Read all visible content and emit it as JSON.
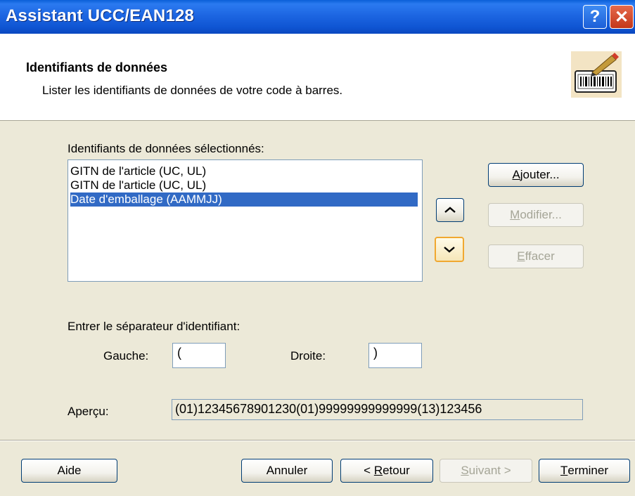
{
  "window": {
    "title": "Assistant UCC/EAN128",
    "help_label": "?",
    "close_label": "✕"
  },
  "header": {
    "title": "Identifiants de données",
    "subtitle": "Lister les identifiants de données de votre code à barres.",
    "icon": "barcode-pen-icon"
  },
  "selected_ids": {
    "label": "Identifiants de données sélectionnés:",
    "items": [
      {
        "label": "GITN de l'article (UC, UL)",
        "selected": false
      },
      {
        "label": "GITN de l'article (UC, UL)",
        "selected": false
      },
      {
        "label": "Date d'emballage (AAMMJJ)",
        "selected": true
      }
    ]
  },
  "side_buttons": {
    "add": {
      "label": "Ajouter...",
      "accel": "A",
      "rest": "jouter...",
      "enabled": true
    },
    "modify": {
      "label": "Modifier...",
      "accel": "M",
      "rest": "odifier...",
      "enabled": false
    },
    "delete": {
      "label": "Effacer",
      "accel": "E",
      "rest": "ffacer",
      "enabled": false
    }
  },
  "separator": {
    "label": "Entrer le séparateur d'identifiant:",
    "left_label": "Gauche:",
    "left_value": "(",
    "right_label": "Droite:",
    "right_value": ")"
  },
  "preview": {
    "label": "Aperçu:",
    "value": "(01)12345678901230(01)99999999999999(13)123456"
  },
  "footer": {
    "help": "Aide",
    "cancel": "Annuler",
    "back": {
      "label": "< Retour",
      "prefix": "< ",
      "accel": "R",
      "rest": "etour",
      "enabled": true
    },
    "next": {
      "label": "Suivant >",
      "accel": "S",
      "rest": "uivant >",
      "enabled": false
    },
    "finish": {
      "label": "Terminer",
      "accel": "T",
      "rest": "erminer",
      "enabled": true
    }
  }
}
